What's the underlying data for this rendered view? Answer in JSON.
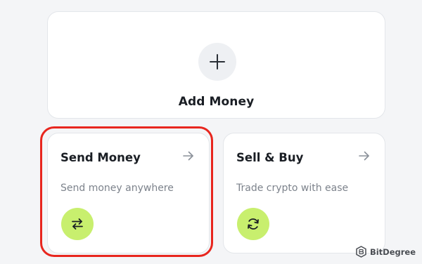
{
  "add_money": {
    "label": "Add Money",
    "icon": "plus-icon"
  },
  "send_money": {
    "title": "Send Money",
    "description": "Send money anywhere",
    "arrow_icon": "arrow-right-icon",
    "action_icon": "swap-arrows-icon",
    "highlighted": true
  },
  "sell_buy": {
    "title": "Sell & Buy",
    "description": "Trade crypto with ease",
    "arrow_icon": "arrow-right-icon",
    "action_icon": "refresh-icon"
  },
  "watermark": {
    "text": "BitDegree",
    "icon": "bitdegree-logo-icon"
  },
  "colors": {
    "background": "#f4f5f7",
    "card": "#ffffff",
    "accent_green": "#c8ef6e",
    "highlight_red": "#e8261e",
    "title_text": "#1a1e24",
    "muted_text": "#7d838c"
  }
}
